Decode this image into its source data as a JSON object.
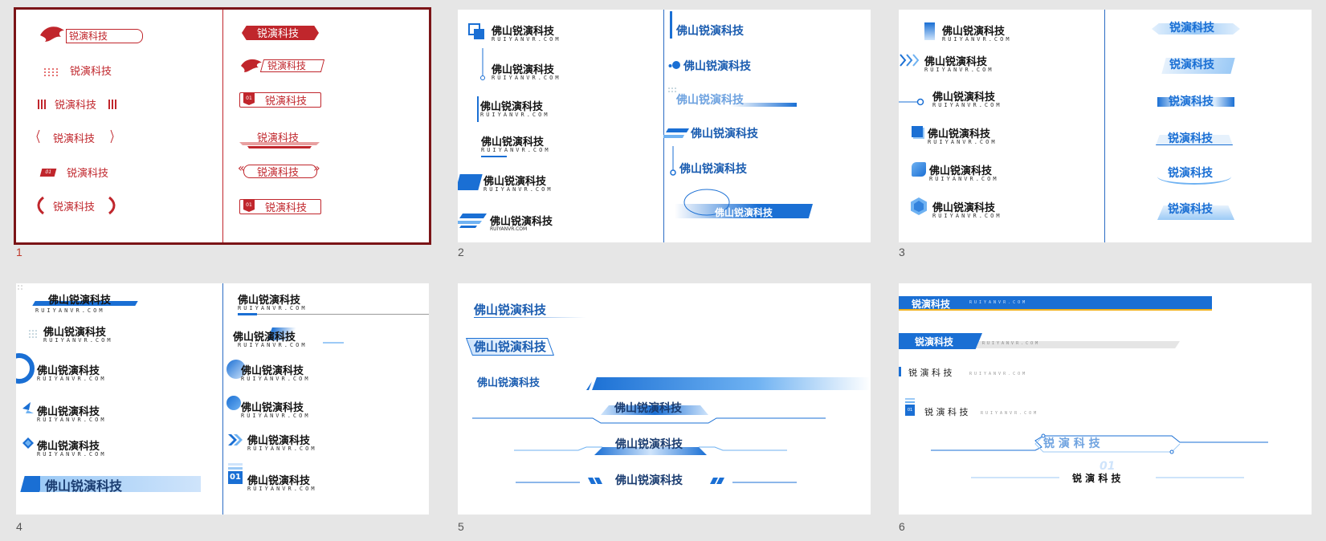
{
  "slides": [
    {
      "number": "1",
      "selected": true
    },
    {
      "number": "2"
    },
    {
      "number": "3"
    },
    {
      "number": "4"
    },
    {
      "number": "5"
    },
    {
      "number": "6"
    }
  ],
  "text": {
    "short": "锐演科技",
    "long": "佛山锐演科技",
    "domain_upper": "RUIYANVR.COM",
    "domain_lower": "RUIYANVR.COM",
    "spaced": "锐 演 科 技",
    "wide": "锐   演   科   技",
    "badge": "01"
  },
  "colors": {
    "red": "#c0262c",
    "dark_red": "#7b1417",
    "blue": "#1a6fd4",
    "light_blue": "#6fb2f2",
    "gold": "#f2b21b"
  },
  "icons": [
    "phoenix-logo",
    "dotted-grid",
    "laurel-branch",
    "chevron-arrows",
    "number-badge"
  ]
}
